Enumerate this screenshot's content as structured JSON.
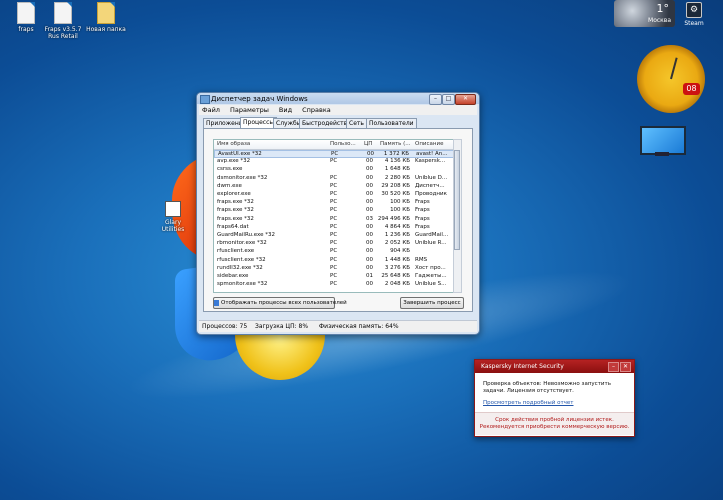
{
  "desktop": {
    "icons": [
      {
        "label": "fraps"
      },
      {
        "label": "Fraps v3.5.7 Rus Retail"
      },
      {
        "label": "Новая папка"
      }
    ],
    "mid_icon_label": "Glary Utilities",
    "weather": {
      "temp": "1°",
      "city": "Москва"
    },
    "steam_label": "Steam",
    "clock_date": "08"
  },
  "taskmanager": {
    "title": "Диспетчер задач Windows",
    "menu": [
      "Файл",
      "Параметры",
      "Вид",
      "Справка"
    ],
    "tabs": [
      "Приложения",
      "Процессы",
      "Службы",
      "Быстродействие",
      "Сеть",
      "Пользователи"
    ],
    "active_tab": "Процессы",
    "columns": [
      "Имя образа",
      "Пользо...",
      "ЦП",
      "Память (...",
      "Описание"
    ],
    "rows": [
      {
        "name": "AvastUI.exe *32",
        "user": "PC",
        "cpu": "00",
        "mem": "1 372 КБ",
        "desc": "avast! An..."
      },
      {
        "name": "avp.exe *32",
        "user": "PC",
        "cpu": "00",
        "mem": "4 136 КБ",
        "desc": "Kaspersk..."
      },
      {
        "name": "csrss.exe",
        "user": "",
        "cpu": "00",
        "mem": "1 648 КБ",
        "desc": ""
      },
      {
        "name": "dsmonitor.exe *32",
        "user": "PC",
        "cpu": "00",
        "mem": "2 280 КБ",
        "desc": "Uniblue D..."
      },
      {
        "name": "dwm.exe",
        "user": "PC",
        "cpu": "00",
        "mem": "29 208 КБ",
        "desc": "Диспетч..."
      },
      {
        "name": "explorer.exe",
        "user": "PC",
        "cpu": "00",
        "mem": "30 520 КБ",
        "desc": "Проводник"
      },
      {
        "name": "fraps.exe *32",
        "user": "PC",
        "cpu": "00",
        "mem": "100 КБ",
        "desc": "Fraps"
      },
      {
        "name": "fraps.exe *32",
        "user": "PC",
        "cpu": "00",
        "mem": "100 КБ",
        "desc": "Fraps"
      },
      {
        "name": "fraps.exe *32",
        "user": "PC",
        "cpu": "03",
        "mem": "294 496 КБ",
        "desc": "Fraps"
      },
      {
        "name": "fraps64.dat",
        "user": "PC",
        "cpu": "00",
        "mem": "4 864 КБ",
        "desc": "Fraps"
      },
      {
        "name": "GuardMailRu.exe *32",
        "user": "PC",
        "cpu": "00",
        "mem": "1 236 КБ",
        "desc": "GuardMail..."
      },
      {
        "name": "rbmonitor.exe *32",
        "user": "PC",
        "cpu": "00",
        "mem": "2 052 КБ",
        "desc": "Uniblue R..."
      },
      {
        "name": "rfusclient.exe",
        "user": "PC",
        "cpu": "00",
        "mem": "904 КБ",
        "desc": ""
      },
      {
        "name": "rfusclient.exe *32",
        "user": "PC",
        "cpu": "00",
        "mem": "1 448 КБ",
        "desc": "RMS"
      },
      {
        "name": "rundll32.exe *32",
        "user": "PC",
        "cpu": "00",
        "mem": "3 276 КБ",
        "desc": "Хост про..."
      },
      {
        "name": "sidebar.exe",
        "user": "PC",
        "cpu": "01",
        "mem": "25 648 КБ",
        "desc": "Гаджеты..."
      },
      {
        "name": "spmonitor.exe *32",
        "user": "PC",
        "cpu": "00",
        "mem": "2 048 КБ",
        "desc": "Uniblue S..."
      }
    ],
    "show_all_button": "Отображать процессы всех пользователей",
    "end_process_button": "Завершить процесс",
    "status": {
      "processes": "Процессов: 75",
      "cpu": "Загрузка ЦП: 8%",
      "memory": "Физическая память: 64%"
    }
  },
  "kaspersky": {
    "title": "Kaspersky Internet Security",
    "message": "Проверка объектов: Невозможно запустить задачи. Лицензия отсутствует.",
    "link": "Просмотреть подробный отчет",
    "footer_line1": "Срок действия пробной лицензии истек.",
    "footer_line2": "Рекомендуется приобрести коммерческую версию."
  }
}
